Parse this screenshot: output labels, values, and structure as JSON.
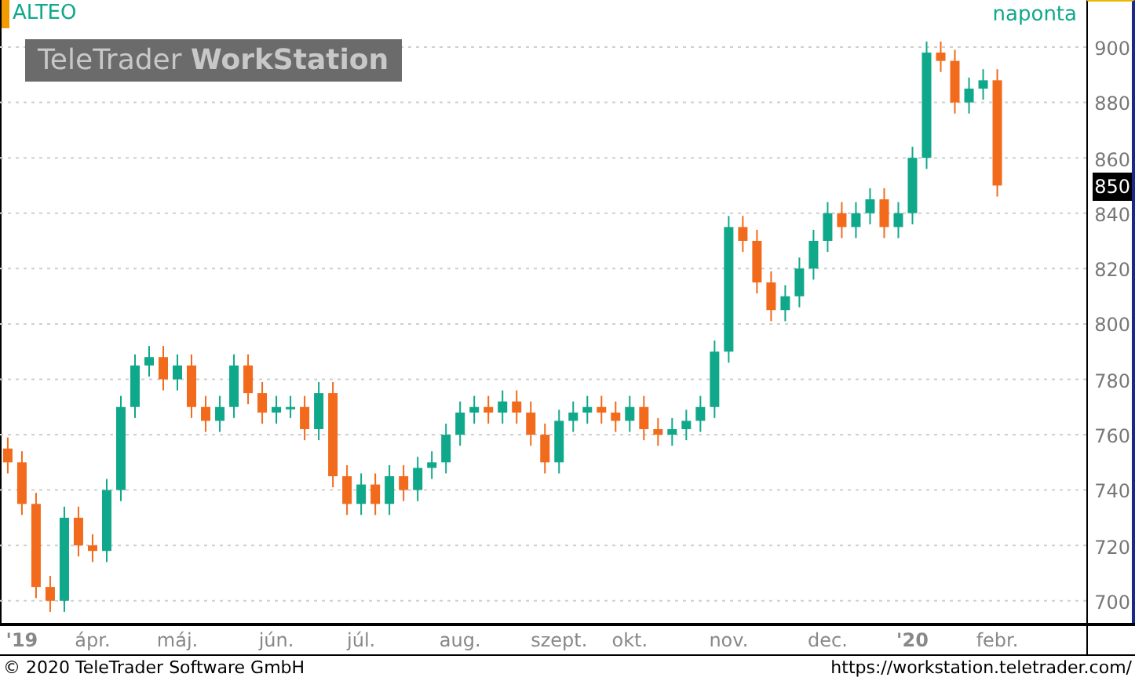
{
  "chart": {
    "interval": "naponta",
    "brand": "TeleTrader **WorkStation**",
    "last_price": "850",
    "chart_data": {
      "type": "candlestick",
      "grid": true,
      "ylim": [
        692,
        917
      ],
      "yticks": [
        700,
        720,
        740,
        760,
        780,
        800,
        820,
        840,
        860,
        880,
        900
      ],
      "categories": [
        null,
        "'19",
        null,
        null,
        null,
        null,
        "ápr.",
        null,
        null,
        null,
        null,
        null,
        "máj.",
        null,
        null,
        null,
        null,
        null,
        null,
        "jún.",
        null,
        null,
        null,
        null,
        null,
        "júl.",
        null,
        null,
        null,
        null,
        null,
        null,
        "aug.",
        null,
        null,
        null,
        null,
        null,
        null,
        "szept.",
        null,
        null,
        null,
        null,
        "okt.",
        null,
        null,
        null,
        null,
        null,
        null,
        "nov.",
        null,
        null,
        null,
        null,
        null,
        null,
        "dec.",
        null,
        null,
        null,
        null,
        null,
        "'20",
        null,
        null,
        null,
        null,
        null,
        "febr."
      ],
      "series": [
        {
          "name": "ALTEO",
          "ohlc": [
            [
              755,
              759,
              746,
              750
            ],
            [
              750,
              754,
              731,
              735
            ],
            [
              735,
              739,
              701,
              705
            ],
            [
              705,
              709,
              696,
              700
            ],
            [
              700,
              734,
              696,
              730
            ],
            [
              730,
              734,
              716,
              720
            ],
            [
              720,
              724,
              714,
              718
            ],
            [
              718,
              744,
              714,
              740
            ],
            [
              740,
              774,
              736,
              770
            ],
            [
              770,
              789,
              766,
              785
            ],
            [
              785,
              792,
              781,
              788
            ],
            [
              788,
              792,
              776,
              780
            ],
            [
              780,
              789,
              776,
              785
            ],
            [
              785,
              789,
              766,
              770
            ],
            [
              770,
              774,
              761,
              765
            ],
            [
              765,
              774,
              761,
              770
            ],
            [
              770,
              789,
              766,
              785
            ],
            [
              785,
              789,
              771,
              775
            ],
            [
              775,
              779,
              764,
              768
            ],
            [
              768,
              774,
              764,
              770
            ],
            [
              770,
              774,
              766,
              770
            ],
            [
              770,
              774,
              758,
              762
            ],
            [
              762,
              779,
              758,
              775
            ],
            [
              775,
              779,
              741,
              745
            ],
            [
              745,
              749,
              731,
              735
            ],
            [
              735,
              746,
              731,
              742
            ],
            [
              742,
              746,
              731,
              735
            ],
            [
              735,
              749,
              731,
              745
            ],
            [
              745,
              749,
              736,
              740
            ],
            [
              740,
              752,
              736,
              748
            ],
            [
              748,
              754,
              744,
              750
            ],
            [
              750,
              764,
              746,
              760
            ],
            [
              760,
              772,
              756,
              768
            ],
            [
              768,
              774,
              764,
              770
            ],
            [
              770,
              774,
              764,
              768
            ],
            [
              768,
              776,
              764,
              772
            ],
            [
              772,
              776,
              764,
              768
            ],
            [
              768,
              772,
              756,
              760
            ],
            [
              760,
              764,
              746,
              750
            ],
            [
              750,
              769,
              746,
              765
            ],
            [
              765,
              772,
              761,
              768
            ],
            [
              768,
              774,
              764,
              770
            ],
            [
              770,
              774,
              764,
              768
            ],
            [
              768,
              772,
              761,
              765
            ],
            [
              765,
              774,
              761,
              770
            ],
            [
              770,
              774,
              758,
              762
            ],
            [
              762,
              766,
              756,
              760
            ],
            [
              760,
              766,
              756,
              762
            ],
            [
              762,
              769,
              758,
              765
            ],
            [
              765,
              774,
              761,
              770
            ],
            [
              770,
              794,
              766,
              790
            ],
            [
              790,
              839,
              786,
              835
            ],
            [
              835,
              839,
              826,
              830
            ],
            [
              830,
              834,
              811,
              815
            ],
            [
              815,
              819,
              801,
              805
            ],
            [
              805,
              814,
              801,
              810
            ],
            [
              810,
              824,
              806,
              820
            ],
            [
              820,
              834,
              816,
              830
            ],
            [
              830,
              844,
              826,
              840
            ],
            [
              840,
              844,
              831,
              835
            ],
            [
              835,
              844,
              831,
              840
            ],
            [
              840,
              849,
              836,
              845
            ],
            [
              845,
              849,
              831,
              835
            ],
            [
              835,
              844,
              831,
              840
            ],
            [
              840,
              864,
              836,
              860
            ],
            [
              860,
              902,
              856,
              898
            ],
            [
              898,
              902,
              891,
              895
            ],
            [
              895,
              899,
              876,
              880
            ],
            [
              880,
              889,
              876,
              885
            ],
            [
              885,
              892,
              881,
              888
            ],
            [
              888,
              892,
              846,
              850
            ]
          ]
        }
      ]
    }
  },
  "footer": {
    "copyright": "© 2020 TeleTrader Software GmbH",
    "url": "https://workstation.teletrader.com/"
  }
}
